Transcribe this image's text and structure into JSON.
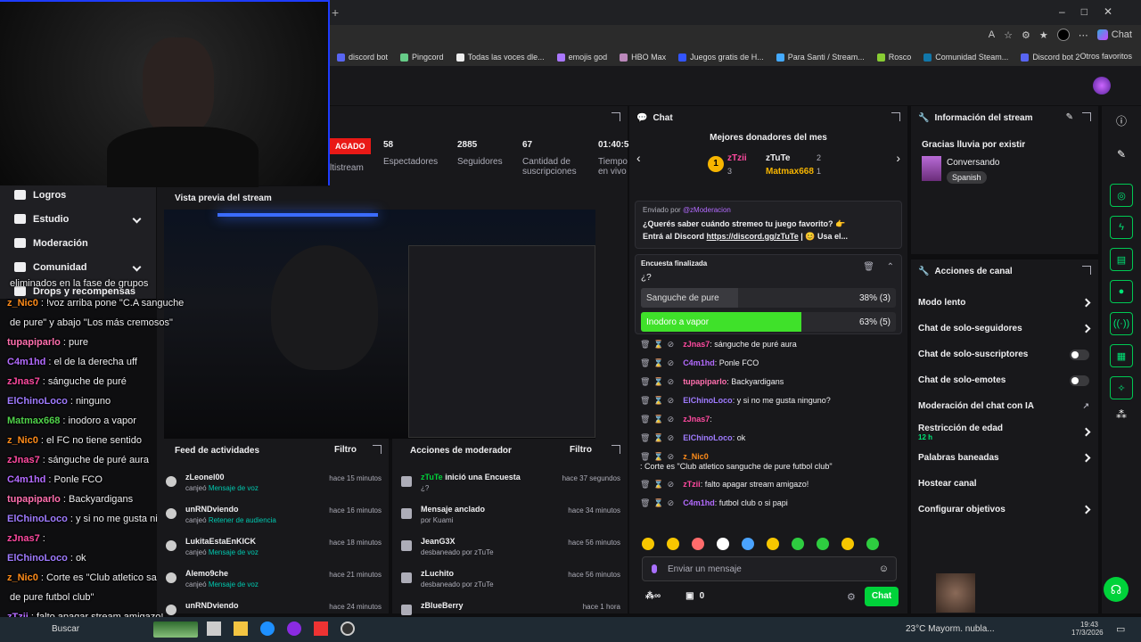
{
  "browser": {
    "bookmarks": [
      "discord bot",
      "Pingcord",
      "Todas las voces dle...",
      "emojis god",
      "HBO Max",
      "Juegos gratis de H...",
      "Para Santi / Stream...",
      "Rosco",
      "Comunidad Steam...",
      "Discord bot 2"
    ],
    "other_bookmarks": "Otros favoritos",
    "chat_button": "Chat"
  },
  "stats": {
    "live_badge": "AGADO",
    "multistream": "ltistream",
    "viewers_value": "58",
    "viewers_label": "Espectadores",
    "followers_value": "2885",
    "followers_label": "Seguidores",
    "subs_value": "67",
    "subs_label": "Cantidad de suscripciones",
    "time_value": "01:40:5",
    "time_label": "Tiempo en vivo"
  },
  "sidebar_nav": [
    {
      "label": "Logros"
    },
    {
      "label": "Estudio"
    },
    {
      "label": "Moderación"
    },
    {
      "label": "Comunidad"
    },
    {
      "label": "Drops y recompensas"
    }
  ],
  "preview": {
    "title": "Vista previa del stream"
  },
  "overlay_chat": [
    {
      "user": "",
      "msg": "eliminados en la fase de grupos"
    },
    {
      "user": "z_Nic0",
      "msg": ": !voz arriba pone \"C.A sanguche"
    },
    {
      "user": "",
      "msg": "de pure\" y abajo \"Los más cremosos\""
    },
    {
      "user": "tupapiparlo",
      "msg": ": pure"
    },
    {
      "user": "C4m1hd",
      "msg": ": el de la derecha uff"
    },
    {
      "user": "zJnas7",
      "msg": ": sánguche de puré"
    },
    {
      "user": "ElChinoLoco",
      "msg": ": ninguno"
    },
    {
      "user": "Matmax668",
      "msg": ": inodoro a vapor"
    },
    {
      "user": "z_Nic0",
      "msg": ": el FC no tiene sentido"
    },
    {
      "user": "zJnas7",
      "msg": ": sánguche de puré aura"
    },
    {
      "user": "C4m1hd",
      "msg": ": Ponle FCO"
    },
    {
      "user": "tupapiparlo",
      "msg": ": Backyardigans"
    },
    {
      "user": "ElChinoLoco",
      "msg": ": y si no me gusta ninguno?"
    },
    {
      "user": "zJnas7",
      "msg": ":"
    },
    {
      "user": "ElChinoLoco",
      "msg": ": ok"
    },
    {
      "user": "z_Nic0",
      "msg": ": Corte es \"Club atletico sanguche"
    },
    {
      "user": "",
      "msg": "de pure futbol club\""
    },
    {
      "user": "zTzii",
      "msg": ": falto apagar stream amigazo!"
    }
  ],
  "activity_feed": {
    "title": "Feed de actividades",
    "filter": "Filtro",
    "items": [
      {
        "name": "zLeonel00",
        "action": "canjeó",
        "reward": "Mensaje de voz",
        "time": "hace 15 minutos"
      },
      {
        "name": "unRNDviendo",
        "action": "canjeó",
        "reward": "Retener de audiencia",
        "time": "hace 16 minutos"
      },
      {
        "name": "LukitaEstaEnKICK",
        "action": "canjeó",
        "reward": "Mensaje de voz",
        "time": "hace 18 minutos"
      },
      {
        "name": "Alemo9che",
        "action": "canjeó",
        "reward": "Mensaje de voz",
        "time": "hace 21 minutos"
      },
      {
        "name": "unRNDviendo",
        "action": "",
        "reward": "",
        "time": "hace 24 minutos"
      }
    ]
  },
  "mod_actions": {
    "title": "Acciones de moderador",
    "filter": "Filtro",
    "items": [
      {
        "name": "zTuTe",
        "text": "inició una Encuesta",
        "sub": "¿?",
        "time": "hace 37 segundos"
      },
      {
        "name": "Mensaje anclado",
        "text": "",
        "sub": "por Kuami",
        "time": "hace 34 minutos"
      },
      {
        "name": "JeanG3X",
        "text": "",
        "sub": "desbaneado por zTuTe",
        "time": "hace 56 minutos"
      },
      {
        "name": "zLuchito",
        "text": "",
        "sub": "desbaneado por zTuTe",
        "time": "hace 56 minutos"
      },
      {
        "name": "zBlueBerry",
        "text": "",
        "sub": "",
        "time": "hace 1 hora"
      }
    ]
  },
  "chat": {
    "title": "Chat",
    "donors_title": "Mejores donadores del mes",
    "donors": [
      {
        "name": "zTzii",
        "count": "3"
      },
      {
        "name": "zTuTe",
        "count": "2"
      },
      {
        "name": "Matmax668",
        "count": "1"
      }
    ],
    "donor_rank": "1",
    "pinned_by": "Enviado por",
    "pinned_author": "@zModeracion",
    "pinned_text_1": "¿Querés saber cuándo stremeo tu juego favorito? 👉",
    "pinned_text_2": "Entrá al Discord",
    "pinned_link": "https://discord.gg/zTuTe",
    "pinned_text_3": "| 😊 Usa el...",
    "poll_status": "Encuesta finalizada",
    "poll_question": "¿?",
    "poll_options": [
      {
        "label": "Sanguche de pure",
        "result": "38% (3)",
        "pct": 38
      },
      {
        "label": "Inodoro a vapor",
        "result": "63% (5)",
        "pct": 63
      }
    ],
    "messages": [
      {
        "user": "zJnas7",
        "msg": ": sánguche de puré aura",
        "color": "#ff4aa0"
      },
      {
        "user": "C4m1hd",
        "msg": ": Ponle FCO",
        "color": "#b36bff"
      },
      {
        "user": "tupapiparlo",
        "msg": ": Backyardigans",
        "color": "#ff6fae"
      },
      {
        "user": "ElChinoLoco",
        "msg": ": y si no me gusta ninguno?",
        "color": "#9f7bff"
      },
      {
        "user": "zJnas7",
        "msg": ":",
        "color": "#ff4aa0"
      },
      {
        "user": "ElChinoLoco",
        "msg": ": ok",
        "color": "#9f7bff"
      },
      {
        "user": "z_Nic0",
        "msg": ": Corte es \"Club atletico sanguche de pure futbol club\"",
        "color": "#ff8c1a"
      },
      {
        "user": "zTzii",
        "msg": ": falto apagar stream amigazo!",
        "color": "#ff4aa0"
      },
      {
        "user": "C4m1hd",
        "msg": ": futbol club o si papi",
        "color": "#b36bff"
      }
    ],
    "input_placeholder": "Enviar un mensaje",
    "points": "0",
    "send": "Chat"
  },
  "stream_info": {
    "title": "Información del stream",
    "stream_title": "Gracias lluvia por existir",
    "category": "Conversando",
    "tag": "Spanish"
  },
  "channel_actions": {
    "title": "Acciones de canal",
    "items": [
      {
        "label": "Modo lento",
        "type": "chevron",
        "sub": ""
      },
      {
        "label": "Chat de solo-seguidores",
        "type": "chevron",
        "sub": ""
      },
      {
        "label": "Chat de solo-suscriptores",
        "type": "toggle",
        "sub": ""
      },
      {
        "label": "Chat de solo-emotes",
        "type": "toggle",
        "sub": ""
      },
      {
        "label": "Moderación del chat con IA",
        "type": "link",
        "sub": ""
      },
      {
        "label": "Restricción de edad",
        "type": "chevron",
        "sub": "12 h"
      },
      {
        "label": "Palabras baneadas",
        "type": "chevron",
        "sub": ""
      },
      {
        "label": "Hostear canal",
        "type": "none",
        "sub": ""
      },
      {
        "label": "Configurar objetivos",
        "type": "chevron",
        "sub": ""
      }
    ]
  },
  "taskbar": {
    "search": "Buscar",
    "weather": "23°C  Mayorm. nubla...",
    "time": "19:43",
    "date": "17/3/2026"
  },
  "colors": {
    "accent": "#00d23a",
    "twitch_bg": "#18181b"
  }
}
